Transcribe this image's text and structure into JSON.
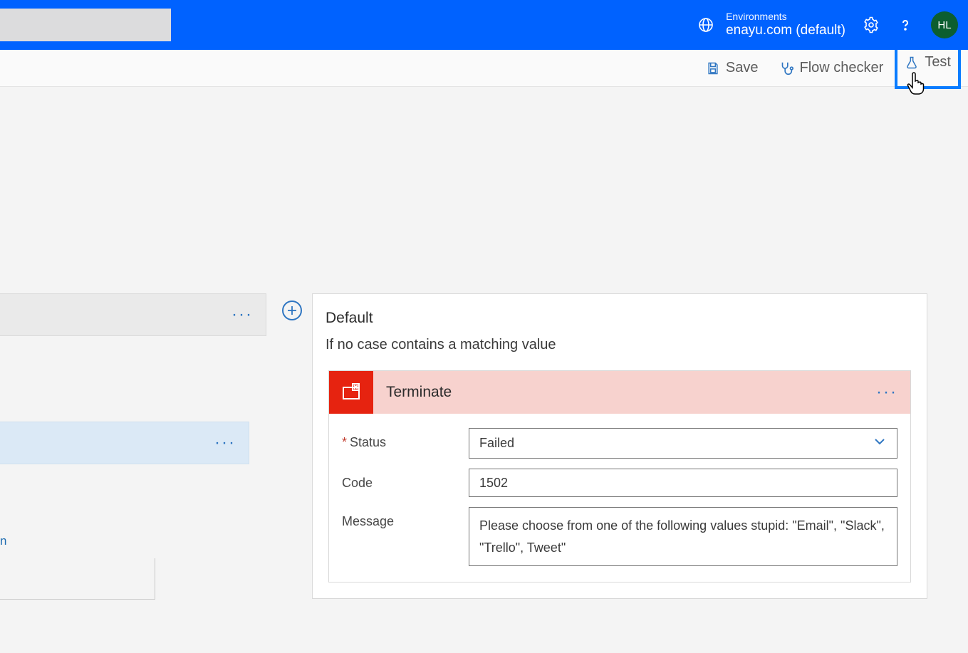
{
  "header": {
    "environments_label": "Environments",
    "environment_name": "enayu.com (default)",
    "avatar_initials": "HL"
  },
  "commandbar": {
    "save": "Save",
    "flow_checker": "Flow checker",
    "test": "Test"
  },
  "left": {
    "link_fragment": "n"
  },
  "default_case": {
    "title": "Default",
    "subtitle": "If no case contains a matching value"
  },
  "terminate": {
    "title": "Terminate",
    "status_label": "Status",
    "status_value": "Failed",
    "code_label": "Code",
    "code_value": "1502",
    "message_label": "Message",
    "message_value": "Please choose from one of the following values stupid: \"Email\", \"Slack\", \"Trello\", Tweet\""
  }
}
